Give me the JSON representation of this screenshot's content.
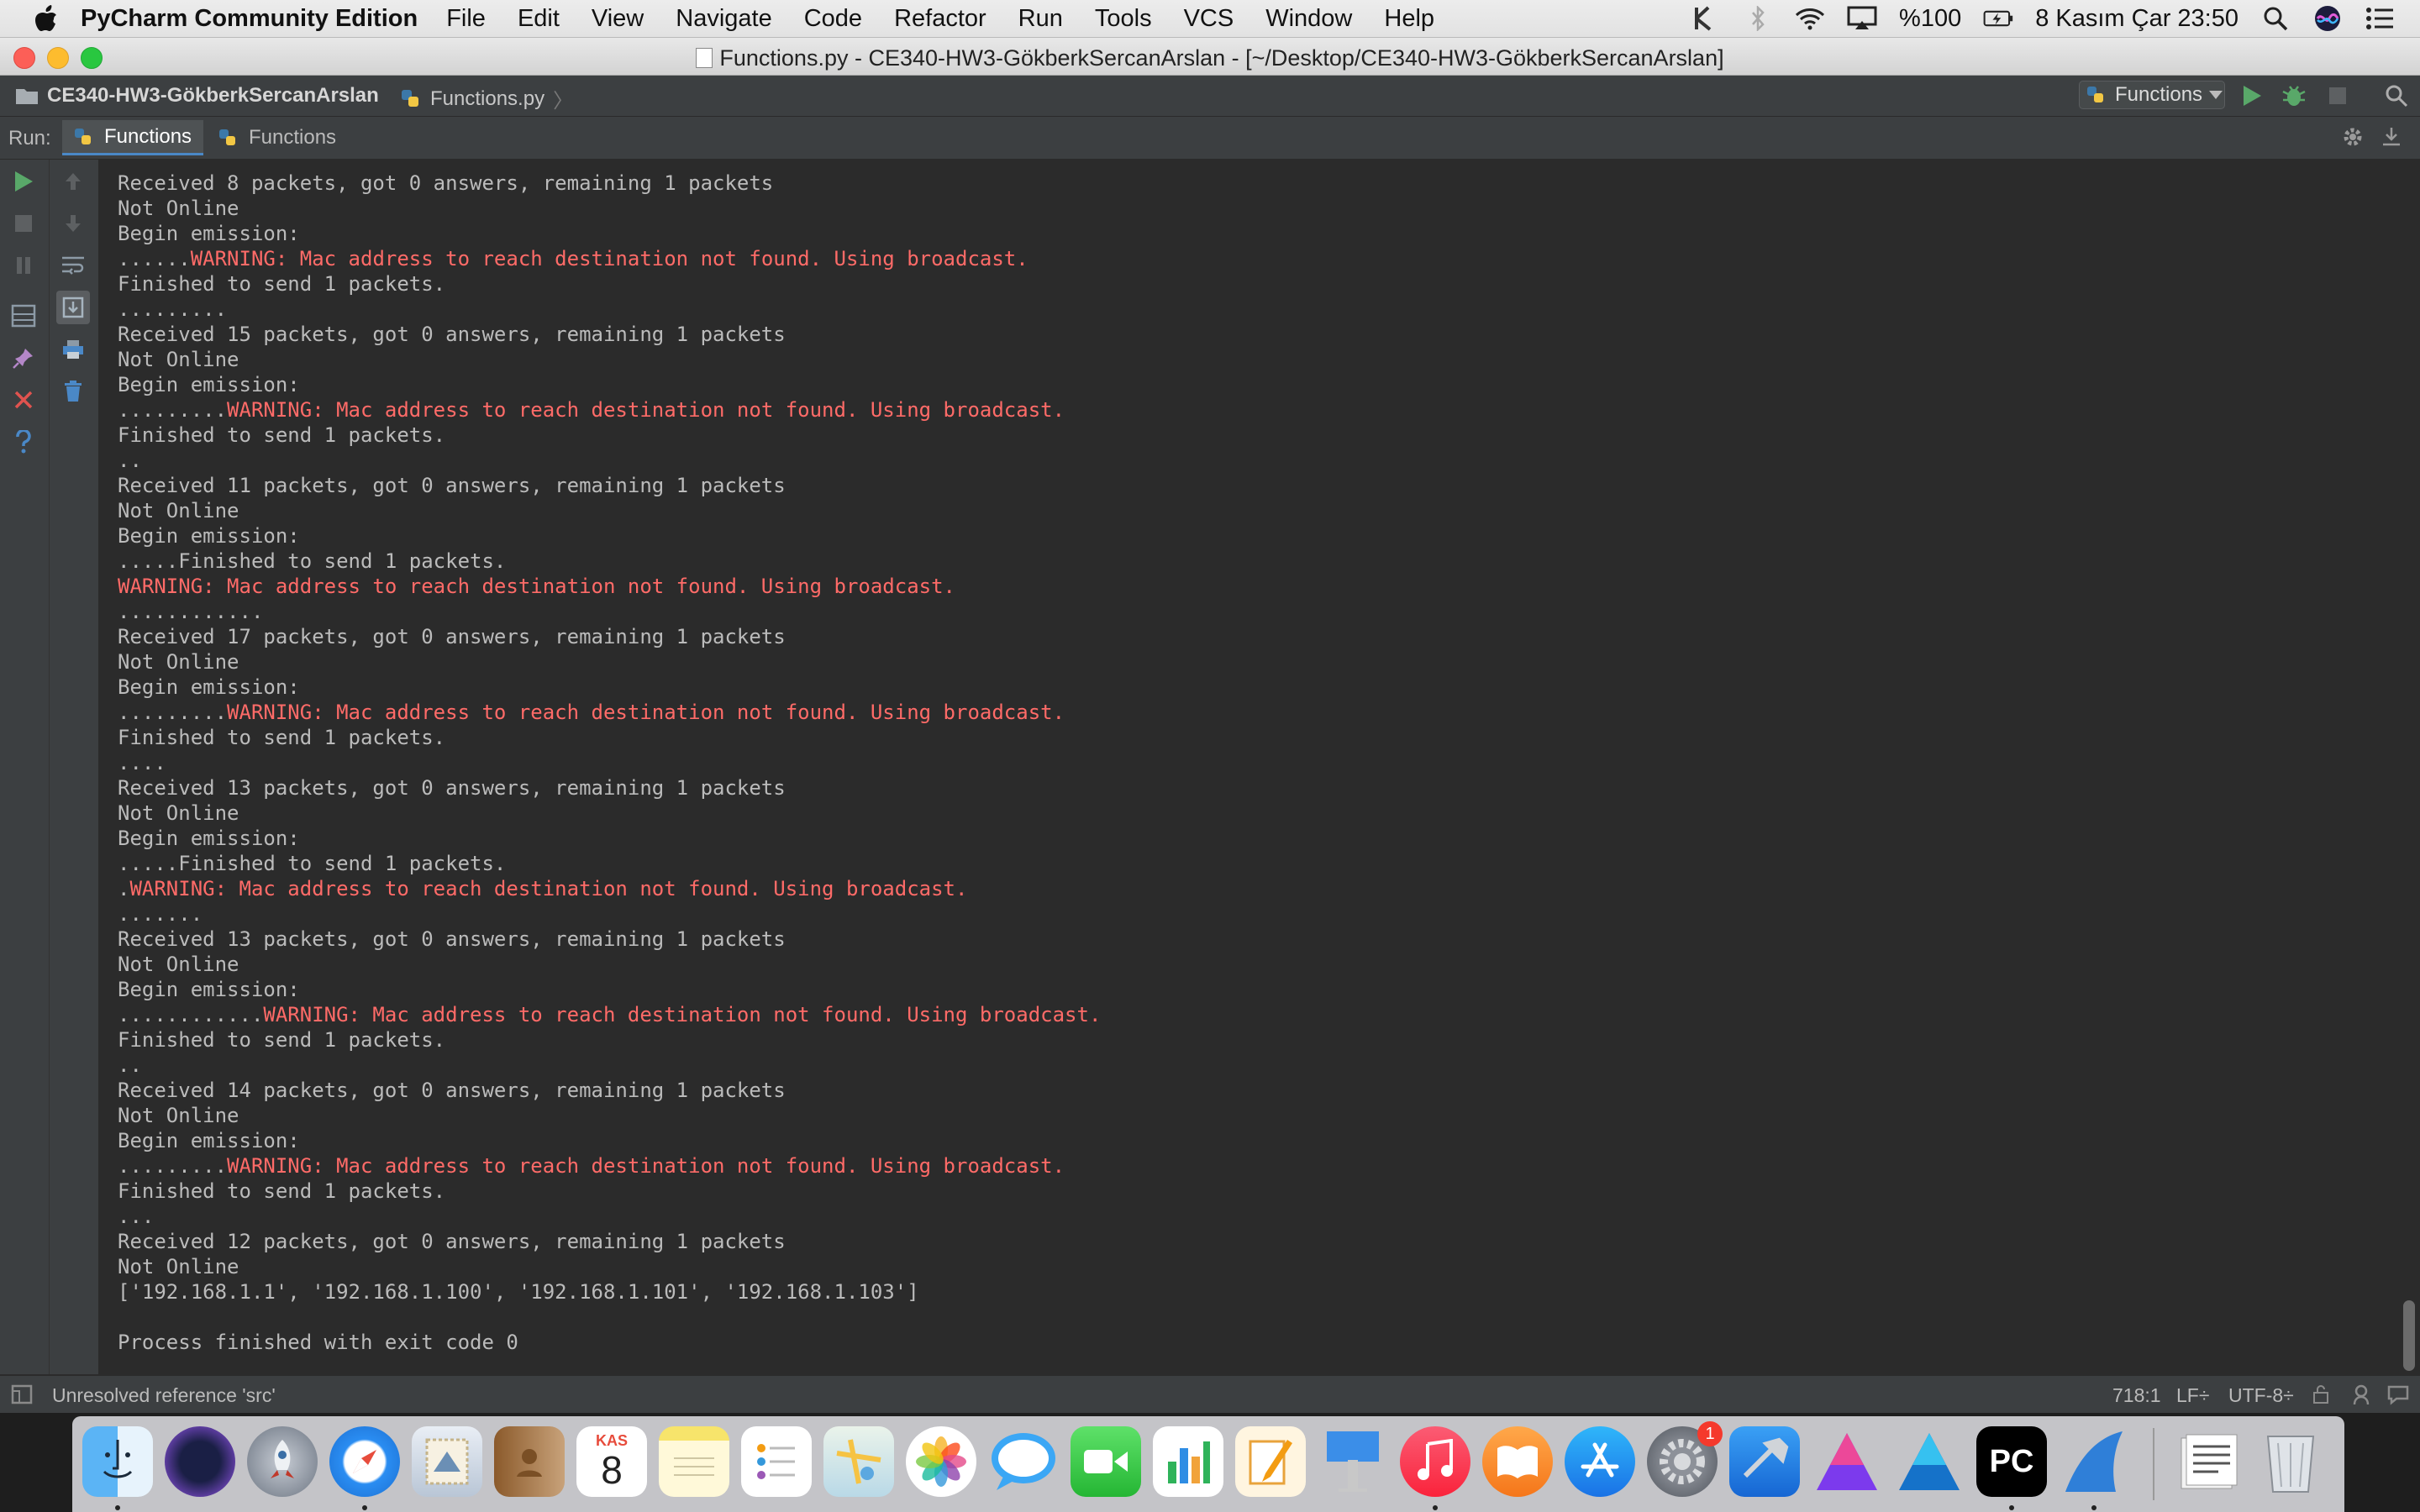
{
  "menubar": {
    "app_name": "PyCharm Community Edition",
    "menus": [
      "File",
      "Edit",
      "View",
      "Navigate",
      "Code",
      "Refactor",
      "Run",
      "Tools",
      "VCS",
      "Window",
      "Help"
    ],
    "battery": "%100",
    "datetime": "8 Kasım Çar  23:50"
  },
  "window": {
    "title": "Functions.py - CE340-HW3-GökberkSercanArslan - [~/Desktop/CE340-HW3-GökberkSercanArslan]"
  },
  "navbar": {
    "project": "CE340-HW3-GökberkSercanArslan",
    "file": "Functions.py",
    "run_config": "Functions"
  },
  "runbar": {
    "label": "Run:",
    "tabs": [
      "Functions",
      "Functions"
    ]
  },
  "console": {
    "lines": [
      {
        "text": "Received 8 packets, got 0 answers, remaining 1 packets"
      },
      {
        "text": "Not Online"
      },
      {
        "text": "Begin emission:"
      },
      {
        "prefix": "......",
        "warn": "WARNING: Mac address to reach destination not found. Using broadcast."
      },
      {
        "text": "Finished to send 1 packets."
      },
      {
        "text": "........."
      },
      {
        "text": "Received 15 packets, got 0 answers, remaining 1 packets"
      },
      {
        "text": "Not Online"
      },
      {
        "text": "Begin emission:"
      },
      {
        "prefix": ".........",
        "warn": "WARNING: Mac address to reach destination not found. Using broadcast."
      },
      {
        "text": "Finished to send 1 packets."
      },
      {
        "text": ".."
      },
      {
        "text": "Received 11 packets, got 0 answers, remaining 1 packets"
      },
      {
        "text": "Not Online"
      },
      {
        "text": "Begin emission:"
      },
      {
        "text": ".....Finished to send 1 packets."
      },
      {
        "prefix": "",
        "warn": "WARNING: Mac address to reach destination not found. Using broadcast."
      },
      {
        "text": "............"
      },
      {
        "text": "Received 17 packets, got 0 answers, remaining 1 packets"
      },
      {
        "text": "Not Online"
      },
      {
        "text": "Begin emission:"
      },
      {
        "prefix": ".........",
        "warn": "WARNING: Mac address to reach destination not found. Using broadcast."
      },
      {
        "text": "Finished to send 1 packets."
      },
      {
        "text": "...."
      },
      {
        "text": "Received 13 packets, got 0 answers, remaining 1 packets"
      },
      {
        "text": "Not Online"
      },
      {
        "text": "Begin emission:"
      },
      {
        "text": ".....Finished to send 1 packets."
      },
      {
        "prefix": ".",
        "warn": "WARNING: Mac address to reach destination not found. Using broadcast."
      },
      {
        "text": "......."
      },
      {
        "text": "Received 13 packets, got 0 answers, remaining 1 packets"
      },
      {
        "text": "Not Online"
      },
      {
        "text": "Begin emission:"
      },
      {
        "prefix": "............",
        "warn": "WARNING: Mac address to reach destination not found. Using broadcast."
      },
      {
        "text": "Finished to send 1 packets."
      },
      {
        "text": ".."
      },
      {
        "text": "Received 14 packets, got 0 answers, remaining 1 packets"
      },
      {
        "text": "Not Online"
      },
      {
        "text": "Begin emission:"
      },
      {
        "prefix": ".........",
        "warn": "WARNING: Mac address to reach destination not found. Using broadcast."
      },
      {
        "text": "Finished to send 1 packets."
      },
      {
        "text": "..."
      },
      {
        "text": "Received 12 packets, got 0 answers, remaining 1 packets"
      },
      {
        "text": "Not Online"
      },
      {
        "text": "['192.168.1.1', '192.168.1.100', '192.168.1.101', '192.168.1.103']"
      },
      {
        "text": ""
      },
      {
        "text": "Process finished with exit code 0"
      }
    ]
  },
  "statusbar": {
    "message": "Unresolved reference 'src'",
    "position": "718:1",
    "line_sep": "LF÷",
    "encoding": "UTF-8÷"
  },
  "dock": {
    "calendar_month": "KAS",
    "calendar_day": "8",
    "badge_count": "1",
    "pycharm_label": "PC"
  },
  "colors": {
    "console_bg": "#2b2b2b",
    "console_text": "#bbbbbb",
    "warning_text": "#ff6b68",
    "run_green": "#59a869"
  }
}
